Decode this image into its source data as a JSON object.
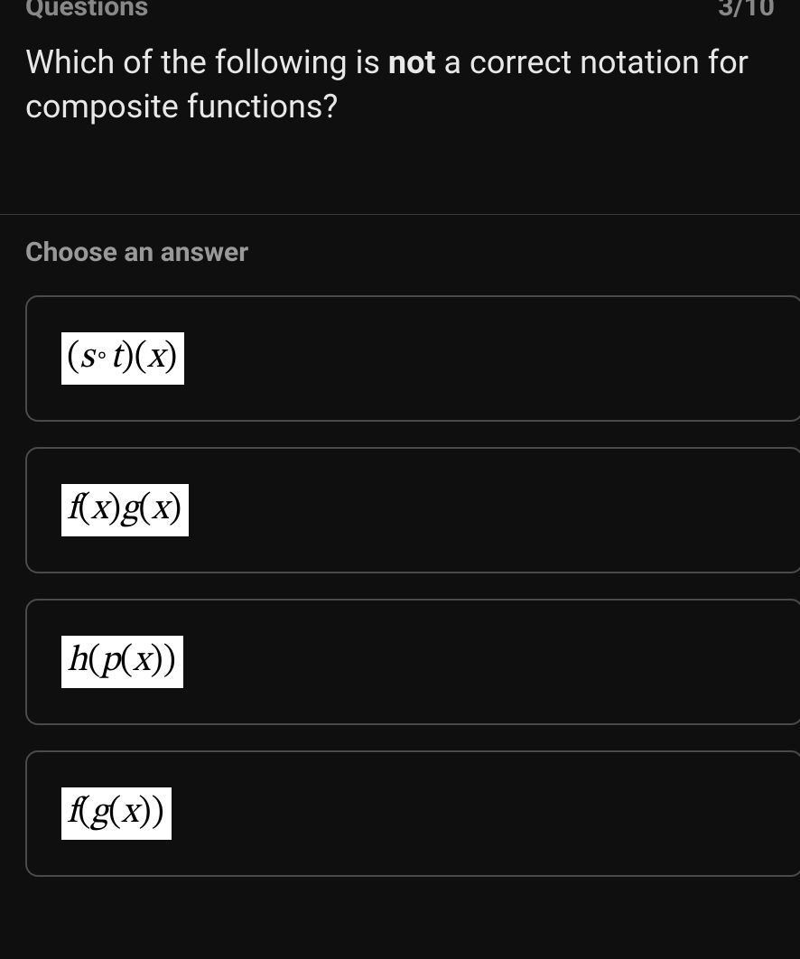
{
  "header": {
    "questions_label": "Questions",
    "progress": "3/10"
  },
  "question": {
    "prefix": "Which of the following is ",
    "emph": "not",
    "suffix": " a correct notation for composite functions?"
  },
  "choose_label": "Choose an answer",
  "answers": [
    {
      "formula_html": "(<span class='italic'>s</span><span class='circ'>∘</span><span class='italic'>t</span>)(<span class='italic'>x</span>)",
      "plain": "(s ∘ t)(x)"
    },
    {
      "formula_html": "<span class='italic'>f</span>(<span class='italic'>x</span>)<span class='italic'>g</span>(<span class='italic'>x</span>)",
      "plain": "f(x)g(x)"
    },
    {
      "formula_html": "<span class='italic'>h</span>(<span class='italic'>p</span>(<span class='italic'>x</span>))",
      "plain": "h(p(x))"
    },
    {
      "formula_html": "<span class='italic'>f</span>(<span class='italic'>g</span>(<span class='italic'>x</span>))",
      "plain": "f(g(x))"
    }
  ]
}
